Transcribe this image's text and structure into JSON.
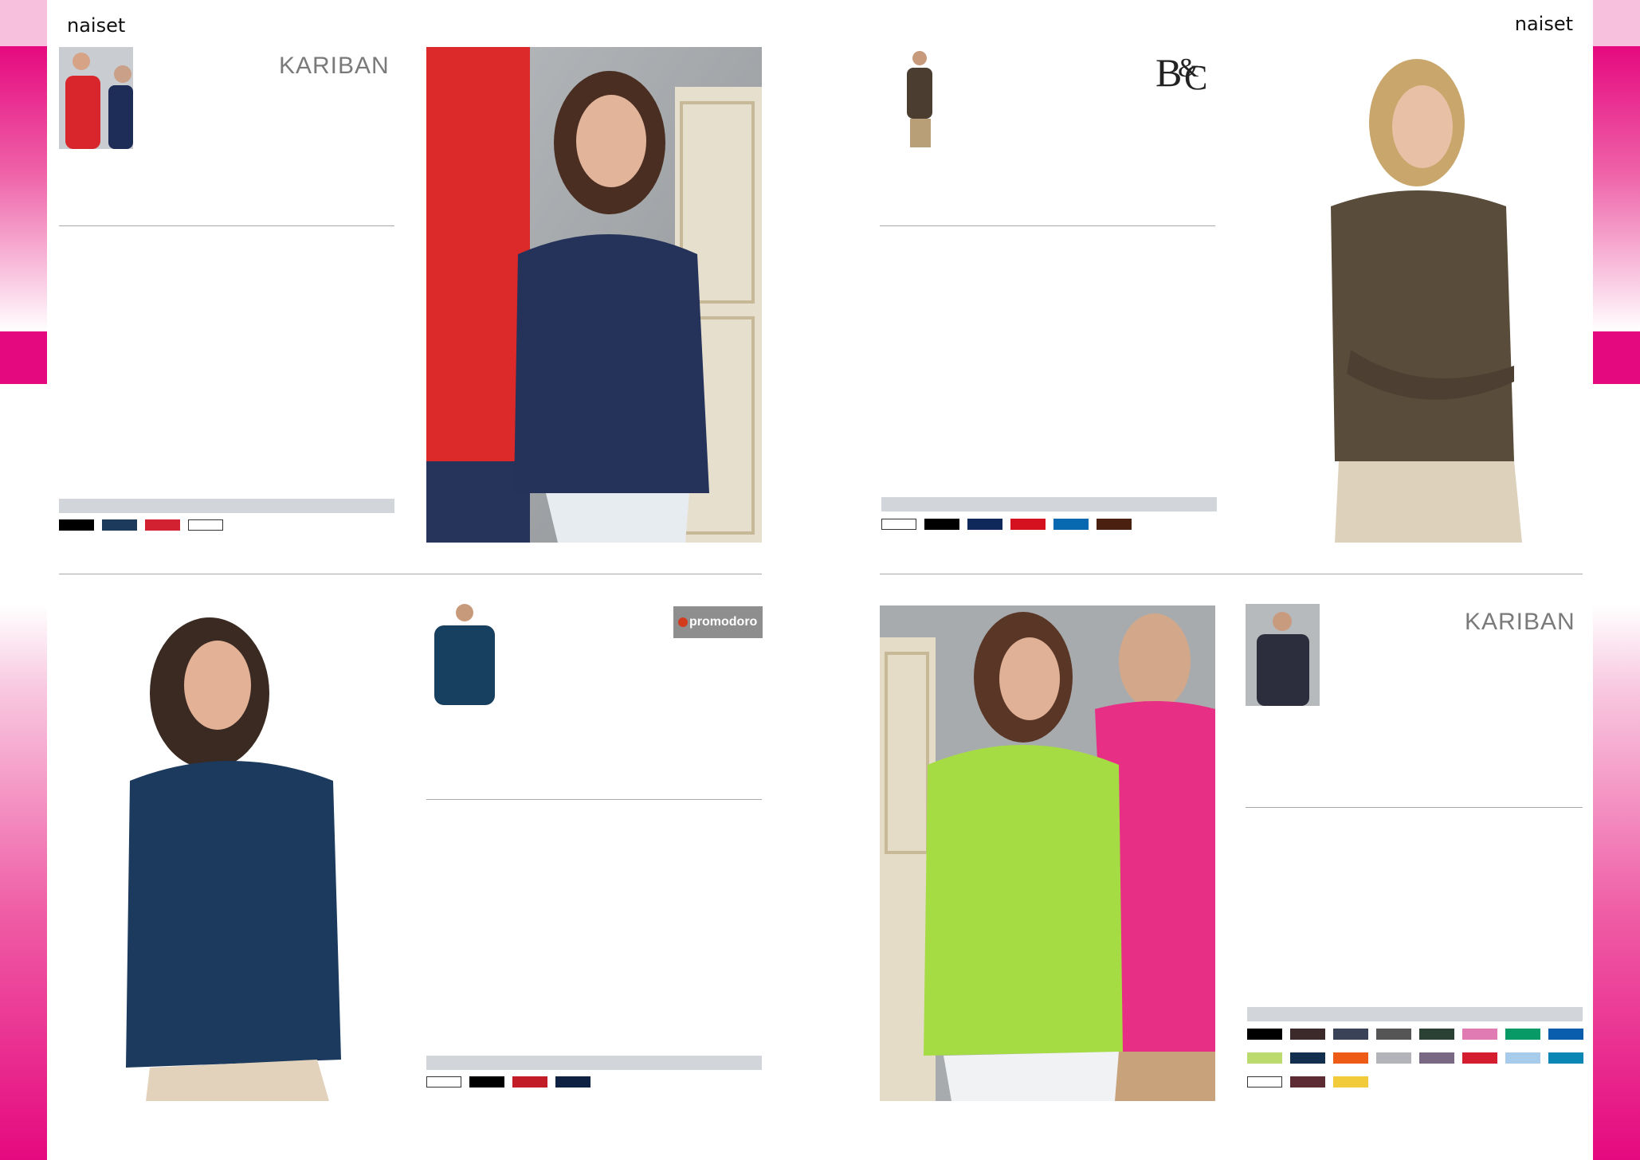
{
  "page": {
    "left_section_label": "naiset",
    "right_section_label": "naiset"
  },
  "colors": {
    "accent_pink": "#e5097f",
    "rule_grey": "#a8a8a8",
    "bar_grey": "#d2d6da"
  },
  "products": [
    {
      "id": "kariban-navy",
      "brand": "KARIBAN",
      "swatches": [
        "#000000",
        "#1b3a5c",
        "#d22231",
        "#ffffff"
      ]
    },
    {
      "id": "bc-brown",
      "brand": "B&C",
      "swatches": [
        "#ffffff",
        "#000000",
        "#0f2a5a",
        "#d5101f",
        "#0868b0",
        "#4a2010"
      ]
    },
    {
      "id": "promodoro-navy",
      "brand": "promodoro",
      "swatches": [
        "#ffffff",
        "#000000",
        "#c21d27",
        "#0f2142"
      ]
    },
    {
      "id": "kariban-lime",
      "brand": "KARIBAN",
      "swatches": [
        "#000000",
        "#3c2a2a",
        "#394257",
        "#555555",
        "#2b4133",
        "#e07bb4",
        "#079a66",
        "#0a5cad",
        "#bcdb6e",
        "#132f50",
        "#ee5b16",
        "#b2b4b9",
        "#786884",
        "#d41e2f",
        "#a7cbea",
        "#0a86b4",
        "#ffffff",
        "#5c2b34",
        "#f2cb3a"
      ]
    }
  ]
}
